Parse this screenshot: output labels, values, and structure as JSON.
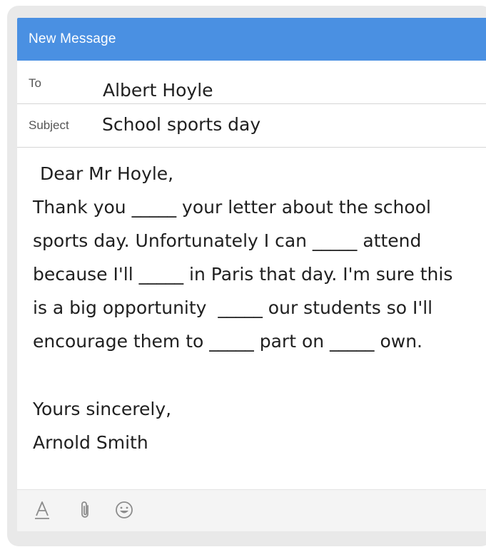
{
  "window": {
    "title": "New Message"
  },
  "fields": {
    "to_label": "To",
    "to_value": "Albert Hoyle",
    "subject_label": "Subject",
    "subject_value": "School sports day"
  },
  "body": {
    "greeting": "Dear Mr Hoyle,",
    "lines": [
      "Thank you _____ your letter about the school",
      "sports day. Unfortunately I can _____ attend",
      "because I'll _____ in Paris that day. I'm sure this",
      "is a big opportunity  _____ our students so I'll",
      "encourage them to _____ part on _____ own."
    ],
    "closing": "Yours sincerely,",
    "signature": "Arnold Smith"
  },
  "toolbar": {
    "icons": [
      "text-format-icon",
      "paperclip-icon",
      "emoji-icon"
    ]
  },
  "colors": {
    "header": "#4a90e2",
    "header_text": "#ffffff",
    "icon": "#8c8c8c"
  }
}
